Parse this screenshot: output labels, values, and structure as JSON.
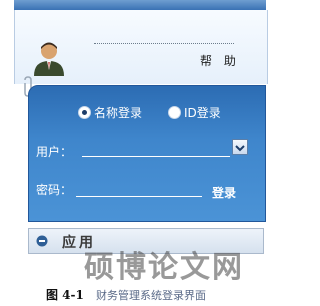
{
  "header": {
    "help_label": "帮 助"
  },
  "login": {
    "modes": [
      {
        "label": "名称登录",
        "selected": true
      },
      {
        "label": "ID登录",
        "selected": false
      }
    ],
    "user_label": "用户：",
    "user_value": "",
    "password_label": "密码：",
    "password_value": "",
    "submit_label": "登录",
    "dropdown_icon": "chevron-down-icon"
  },
  "app_strip": {
    "label": "应用",
    "icon": "app-icon"
  },
  "watermark": {
    "text": "硕博论文网"
  },
  "caption": {
    "number": "图 4-1",
    "text": "财务管理系统登录界面"
  },
  "colors": {
    "panel_blue": "#3f86cc",
    "panel_border": "#22579a",
    "header_bg": "#eef5fc"
  }
}
